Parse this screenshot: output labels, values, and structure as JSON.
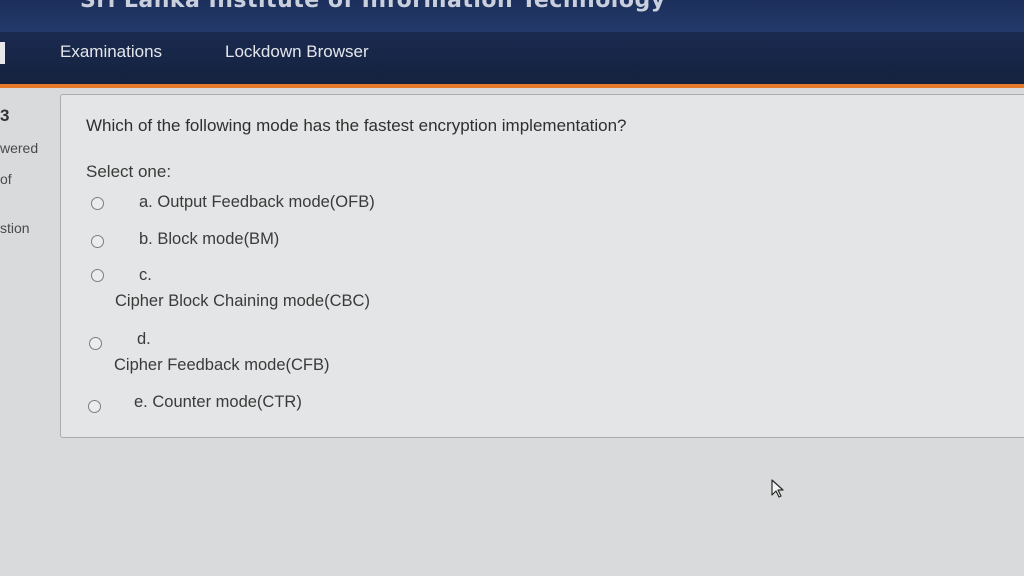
{
  "header": {
    "site_title": "Sri Lanka Institute of Information Technology"
  },
  "nav": {
    "items": [
      "Examinations",
      "Lockdown Browser"
    ]
  },
  "sidebar": {
    "number": "3",
    "answered": "wered",
    "of": "of",
    "question": "stion"
  },
  "quiz": {
    "question": "Which of the following mode has the fastest encryption implementation?",
    "prompt": "Select one:",
    "options": [
      {
        "letter": "a.",
        "text": "Output Feedback mode(OFB)"
      },
      {
        "letter": "b.",
        "text": "Block mode(BM)"
      },
      {
        "letter": "c.",
        "text": "Cipher Block Chaining mode(CBC)"
      },
      {
        "letter": "d.",
        "text": "Cipher Feedback mode(CFB)"
      },
      {
        "letter": "e.",
        "text": "Counter mode(CTR)"
      }
    ]
  },
  "colors": {
    "nav_bg": "#1a2a4f",
    "accent": "#e6782a",
    "page_bg": "#d9dadb"
  },
  "icons": {
    "cursor": "mouse-pointer-icon"
  }
}
